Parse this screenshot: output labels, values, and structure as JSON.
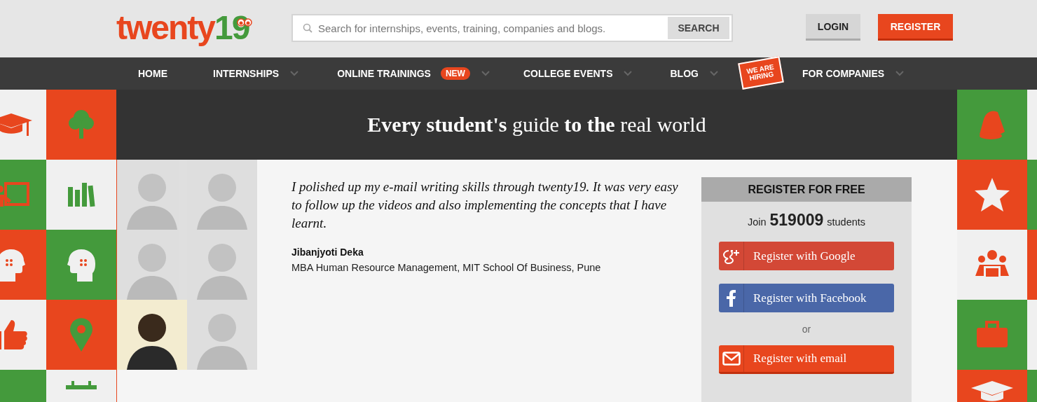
{
  "logo": {
    "word": "twenty",
    "number": "19"
  },
  "search": {
    "placeholder": "Search for internships, events, training, companies and blogs.",
    "button": "SEARCH"
  },
  "auth": {
    "login": "LOGIN",
    "register": "REGISTER"
  },
  "nav": [
    {
      "label": "HOME",
      "caret": false
    },
    {
      "label": "INTERNSHIPS",
      "caret": true
    },
    {
      "label": "ONLINE TRAININGS",
      "badge": "NEW",
      "caret": true
    },
    {
      "label": "COLLEGE EVENTS",
      "caret": true
    },
    {
      "label": "BLOG",
      "caret": true,
      "sign": "WE ARE HIRING"
    },
    {
      "label": "FOR COMPANIES",
      "caret": true
    }
  ],
  "headline": "**Every student's** guide **to the** real world",
  "photos": [
    {
      "selected": false
    },
    {
      "selected": false
    },
    {
      "selected": false
    },
    {
      "selected": false
    },
    {
      "selected": true
    },
    {
      "selected": false
    }
  ],
  "testimonial": {
    "quote": "I polished up my e-mail writing skills through twenty19. It was very easy to follow up the videos and also implementing the concepts that I have learnt.",
    "name": "Jibanjyoti Deka",
    "detail": "MBA Human Resource Management, MIT School Of Business, Pune"
  },
  "register": {
    "title": "REGISTER FOR FREE",
    "join": "Join",
    "count": "519009",
    "students": "students",
    "or": "or",
    "buttons": [
      {
        "kind": "google",
        "label": "Register with Google"
      },
      {
        "kind": "facebook",
        "label": "Register with Facebook"
      },
      {
        "kind": "email",
        "label": "Register with email"
      }
    ]
  }
}
